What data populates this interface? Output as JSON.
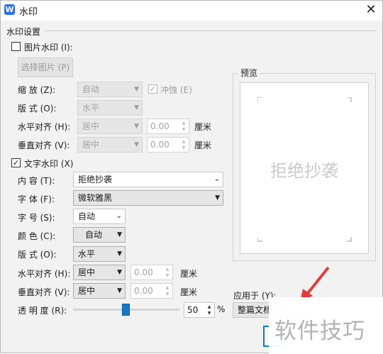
{
  "window": {
    "title": "水印",
    "close_glyph": "✕"
  },
  "settings": {
    "section_label": "水印设置"
  },
  "picture": {
    "checkbox_label": "图片水印 (I):",
    "checked": false,
    "select_button": "选择图片 (P)",
    "scale_label": "缩    放 (Z):",
    "scale_value": "自动",
    "washout_label": "冲蚀 (E)",
    "washout_checked": true,
    "layout_label": "版    式 (O):",
    "layout_value": "水平",
    "halign_label": "水平对齐 (H):",
    "halign_value": "居中",
    "halign_offset": "0.00",
    "valign_label": "垂直对齐 (V):",
    "valign_value": "居中",
    "valign_offset": "0.00",
    "unit": "厘米"
  },
  "text": {
    "checkbox_label": "文字水印 (X)",
    "checked": true,
    "content_label": "内    容 (T):",
    "content_value": "拒绝抄袭",
    "font_label": "字    体 (F):",
    "font_value": "微软雅黑",
    "size_label": "字    号 (S):",
    "size_value": "自动",
    "color_label": "颜    色 (C):",
    "color_value": "自动",
    "layout_label": "版    式 (O):",
    "layout_value": "水平",
    "halign_label": "水平对齐 (H):",
    "halign_value": "居中",
    "halign_offset": "0.00",
    "valign_label": "垂直对齐 (V):",
    "valign_value": "居中",
    "valign_offset": "0.00",
    "unit": "厘米",
    "transparency_label": "透 明 度 (R):",
    "transparency_value": "50",
    "transparency_unit": "%"
  },
  "preview": {
    "label": "预览",
    "watermark_text": "拒绝抄袭"
  },
  "apply": {
    "label": "应用于 (Y):",
    "value": "整篇文档"
  },
  "overlay": {
    "text": "软件技巧"
  },
  "colors": {
    "accent": "#1479c8",
    "annotation_arrow": "#e23b3b"
  }
}
